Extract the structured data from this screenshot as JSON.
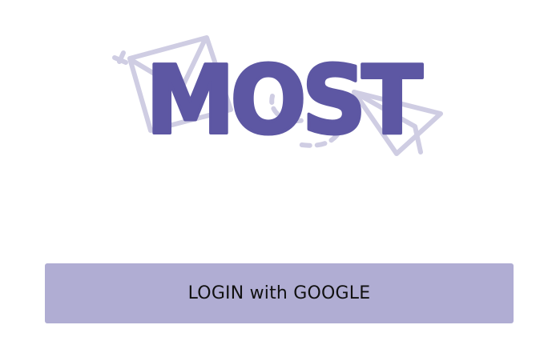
{
  "logo": {
    "wordmark": "MOST"
  },
  "login": {
    "label": "LOGIN with GOOGLE"
  },
  "colors": {
    "brand": "#5d57a3",
    "doodle": "#cfcde3",
    "button_bg": "#b0add3",
    "button_text": "#111111",
    "background": "#ffffff"
  },
  "icons": {
    "envelope": "envelope-icon",
    "paper_plane": "paper-plane-icon"
  }
}
